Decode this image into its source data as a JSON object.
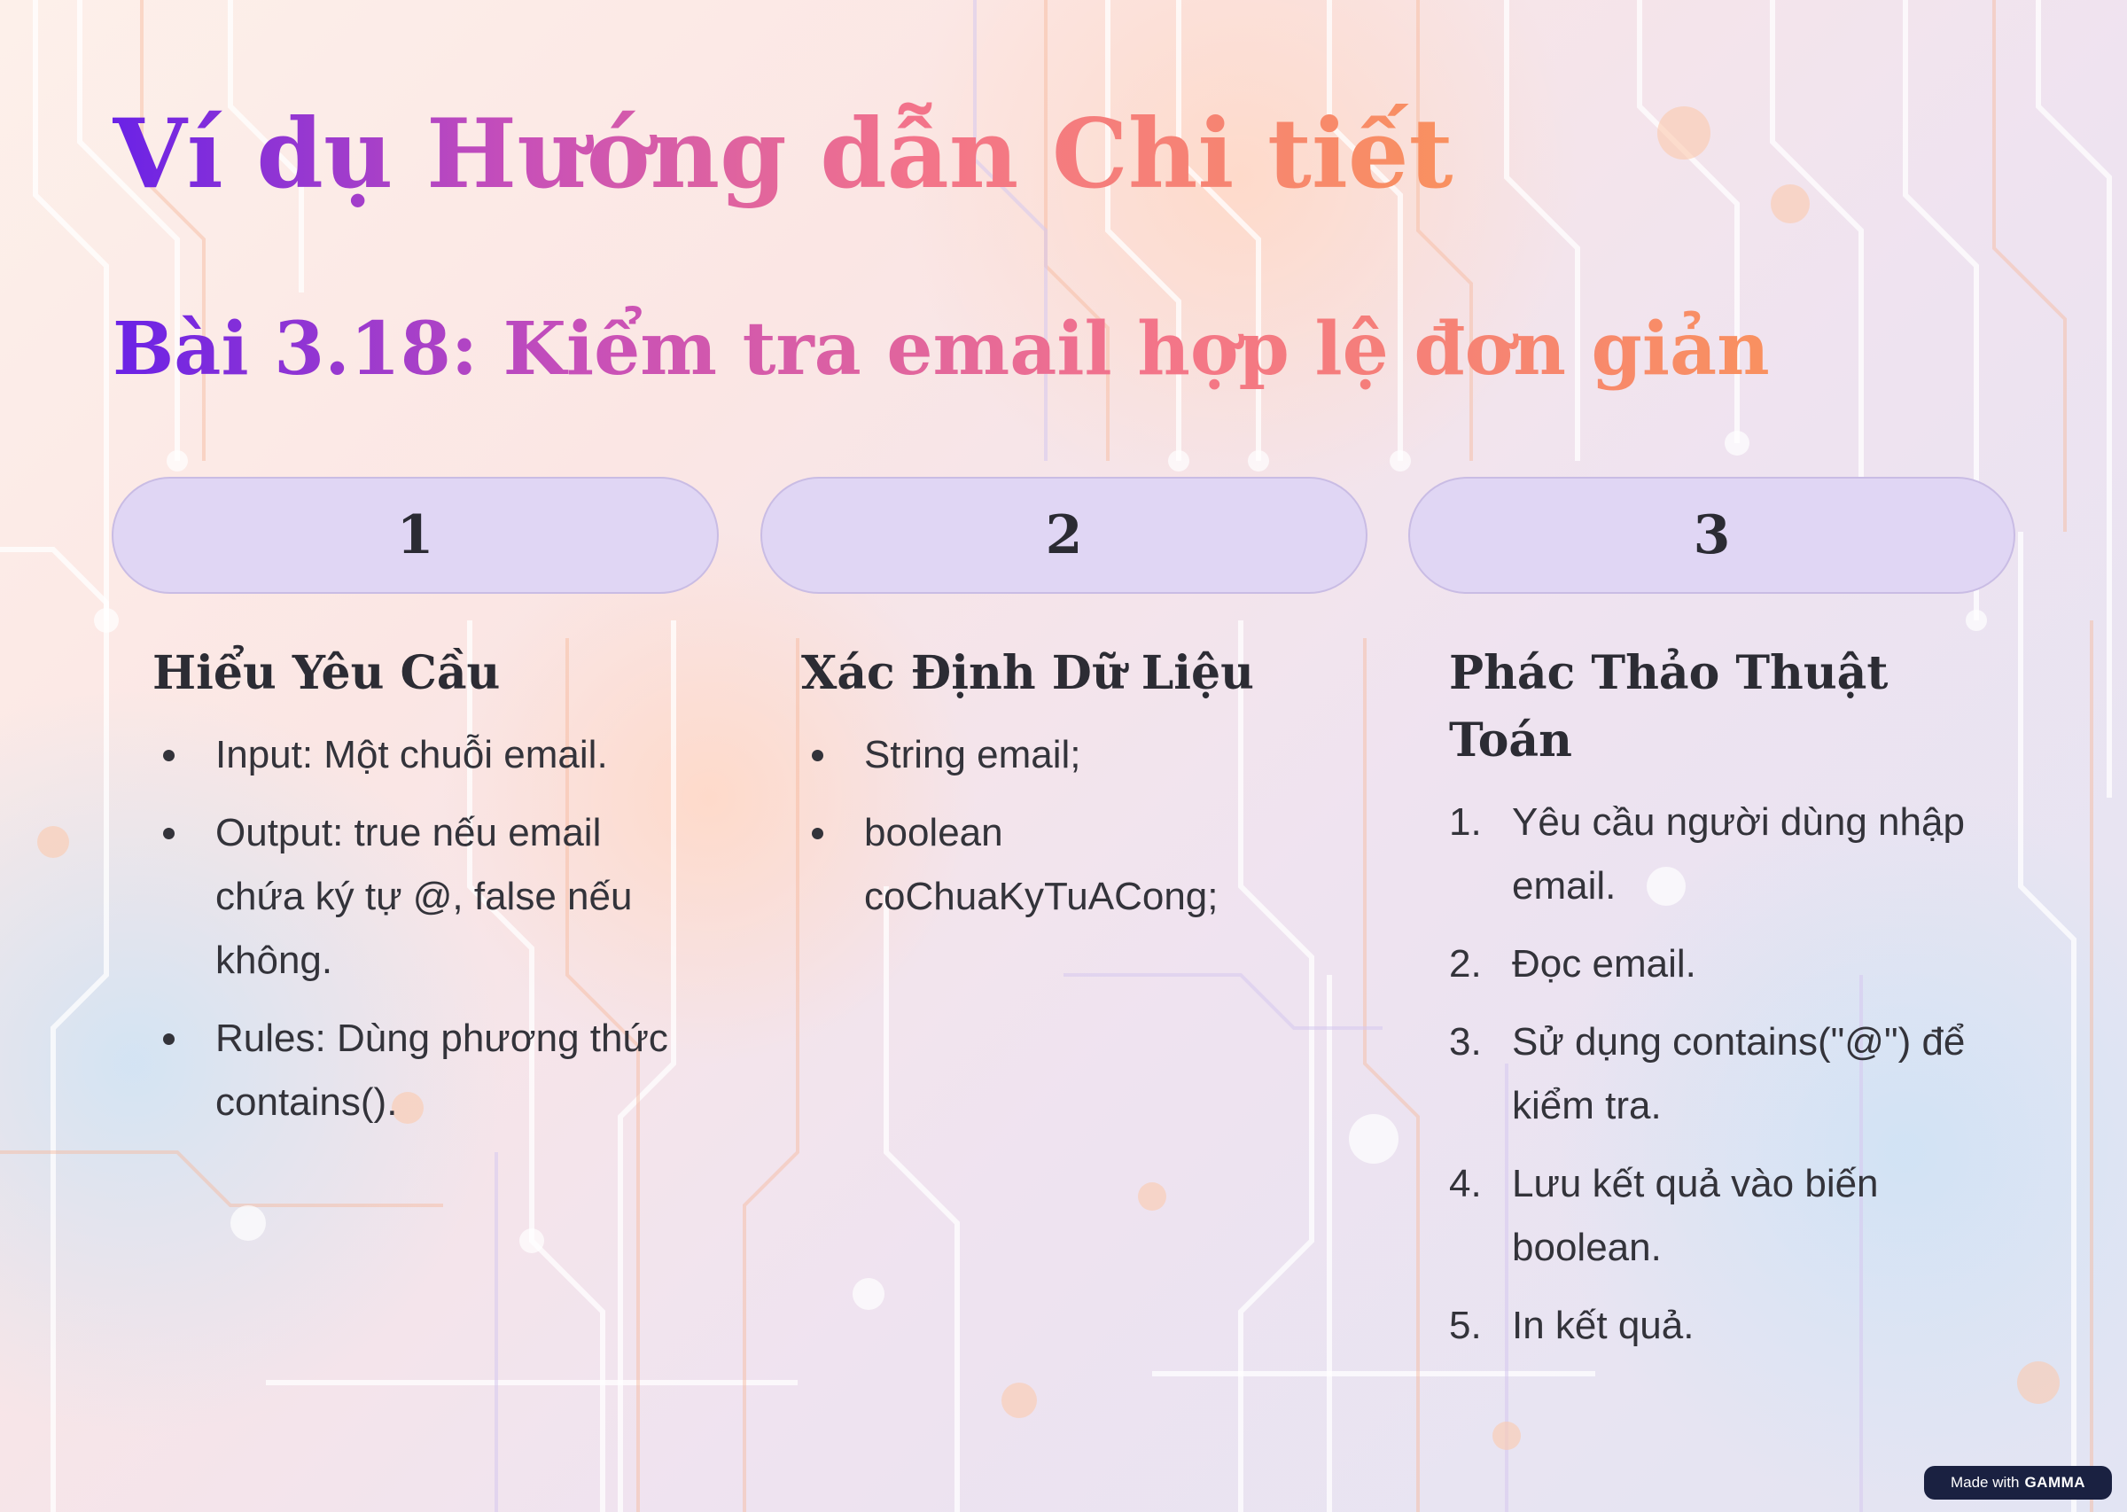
{
  "slide": {
    "title": "Ví dụ Hướng dẫn Chi tiết",
    "subtitle": "Bài 3.18: Kiểm tra email hợp lệ đơn giản"
  },
  "columns": [
    {
      "number": "1",
      "heading": "Hiểu Yêu Cầu",
      "list_type": "bullet",
      "items": [
        "Input: Một chuỗi email.",
        "Output: true nếu email chứa ký tự @, false nếu không.",
        "Rules: Dùng phương thức contains()."
      ]
    },
    {
      "number": "2",
      "heading": "Xác Định Dữ Liệu",
      "list_type": "bullet",
      "items": [
        "String email;",
        "boolean coChuaKyTuACong;"
      ]
    },
    {
      "number": "3",
      "heading": "Phác Thảo Thuật Toán",
      "list_type": "numbered",
      "items": [
        "Yêu cầu người dùng nhập email.",
        "Đọc email.",
        "Sử dụng contains(\"@\") để kiểm tra.",
        "Lưu kết quả vào biến boolean.",
        "In kết quả."
      ],
      "item_numbers": [
        "1.",
        "2.",
        "3.",
        "4.",
        "5."
      ]
    }
  ],
  "badge": {
    "prefix": "Made with",
    "brand": "GAMMA"
  },
  "colors": {
    "gradient_start": "#6a22e6",
    "gradient_mid": "#f3748a",
    "gradient_end": "#f99160",
    "pill_fill": "#e0d6f4",
    "text_dark": "#2c2c34",
    "badge_bg": "#1a2141"
  },
  "background": {
    "image_subject": "circuit-board-pattern"
  }
}
